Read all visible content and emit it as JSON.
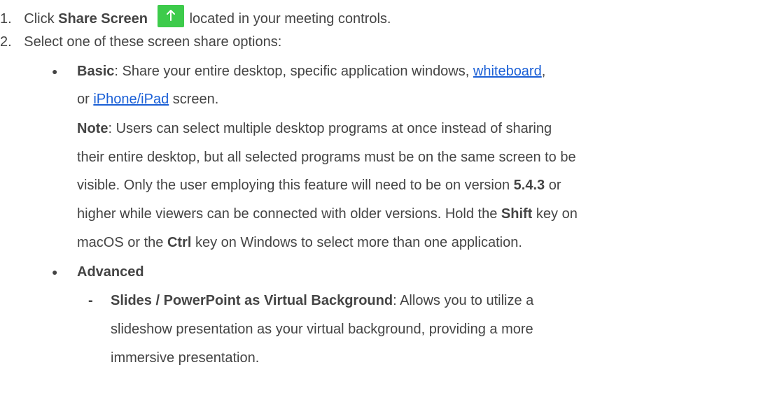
{
  "steps": {
    "one_num": "1.",
    "one_prefix": "Click ",
    "one_bold": "Share Screen",
    "one_suffix": "located in your meeting controls.",
    "two_num": "2.",
    "two_text": "Select one of these screen share options:"
  },
  "share_icon": {
    "name": "arrow-up-icon",
    "color": "#3dcb4b"
  },
  "basic": {
    "label": "Basic",
    "text1": ": Share your entire desktop, specific application windows, ",
    "link_whiteboard": "whiteboard",
    "comma": ",",
    "or": "or ",
    "link_iphone": "iPhone/iPad",
    "screen": " screen.",
    "note_label": "Note",
    "note_1": ": Users can select multiple desktop programs at once instead of sharing",
    "note_2": "their entire desktop, but all selected programs must be on the same screen to be",
    "note_3a": "visible. Only the user employing this feature will need to be on version ",
    "version": "5.4.3",
    "note_3b": " or",
    "note_4a": "higher while viewers can be connected with older versions. Hold the ",
    "shift": "Shift",
    "note_4b": " key on",
    "note_5a": "macOS or the ",
    "ctrl": "Ctrl",
    "note_5b": " key on Windows to select more than one application."
  },
  "advanced": {
    "label": "Advanced",
    "slides_label": "Slides / PowerPoint as Virtual Background",
    "slides_1": ": Allows you to utilize a",
    "slides_2": "slideshow presentation as your virtual background, providing a more",
    "slides_3": "immersive presentation."
  }
}
